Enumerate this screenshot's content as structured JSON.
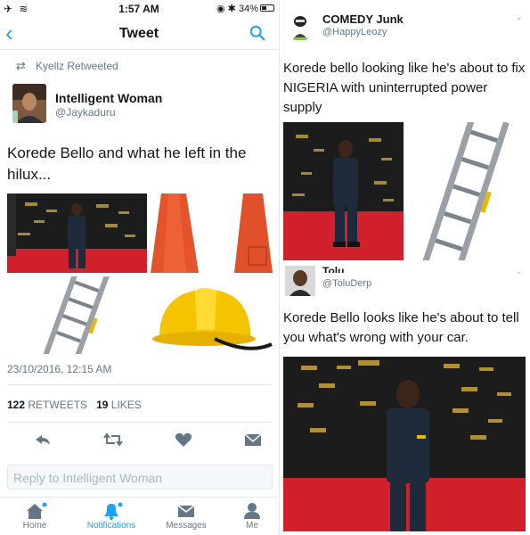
{
  "status_bar": {
    "time": "1:57 AM",
    "battery": "34%"
  },
  "nav": {
    "title": "Tweet",
    "back_icon": "chevron-left-icon",
    "search_icon": "search-icon"
  },
  "retweet_banner": "Kyellz Retweeted",
  "tweet": {
    "author_name": "Intelligent Woman",
    "author_handle": "@Jaykaduru",
    "text": "Korede Bello and what he left in the hilux...",
    "timestamp": "23/10/2016, 12:15 AM",
    "retweets_count": "122",
    "retweets_label": "RETWEETS",
    "likes_count": "19",
    "likes_label": "LIKES",
    "media": [
      "man-in-overalls-photo",
      "traffic-cones-photo",
      "ladder-photo",
      "hard-hat-photo"
    ]
  },
  "reply_placeholder": "Reply to Intelligent Woman",
  "tab_bar": [
    {
      "label": "Home",
      "icon": "home-icon",
      "active": false
    },
    {
      "label": "Notifications",
      "icon": "bell-icon",
      "active": true
    },
    {
      "label": "Messages",
      "icon": "envelope-icon",
      "active": false
    },
    {
      "label": "Me",
      "icon": "person-icon",
      "active": false
    }
  ],
  "right_tweets": [
    {
      "author_name": "COMEDY Junk",
      "author_handle": "@HappyLeozy",
      "text": "Korede bello looking like he's about to fix NIGERIA with uninterrupted power supply"
    },
    {
      "author_name": "Tolu.",
      "author_handle": "@ToluDerp",
      "text": "Korede Bello looks like he's about to tell you what's wrong with your car."
    }
  ],
  "colors": {
    "accent": "#1da1f2",
    "secondary_text": "#657786",
    "divider": "#e1e8ed"
  }
}
